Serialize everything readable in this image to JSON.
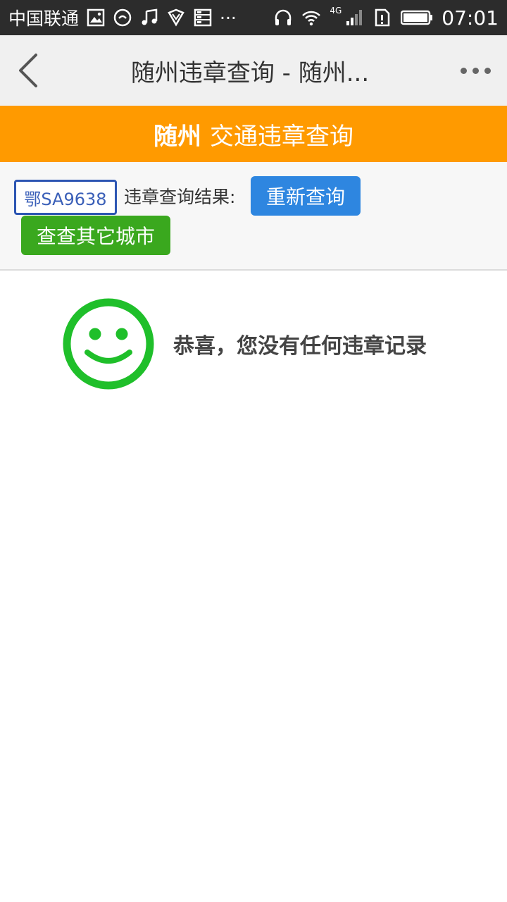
{
  "status_bar": {
    "carrier": "中国联通",
    "more": "···",
    "network": "4G",
    "time": "07:01"
  },
  "nav": {
    "title": "随州违章查询 - 随州..."
  },
  "banner": {
    "city": "随州",
    "title": "交通违章查询"
  },
  "result": {
    "plate": "鄂SA9638",
    "label": "违章查询结果:",
    "requery_button": "重新查询",
    "other_city_button": "查查其它城市",
    "message": "恭喜，您没有任何违章记录"
  },
  "colors": {
    "banner": "#ff9a00",
    "requery": "#2e86e0",
    "other_city": "#3aa81e",
    "smile": "#1fbf2a",
    "plate_border": "#2d56b3"
  },
  "icons": [
    "back-chevron-icon",
    "more-dots-icon",
    "smile-icon"
  ]
}
